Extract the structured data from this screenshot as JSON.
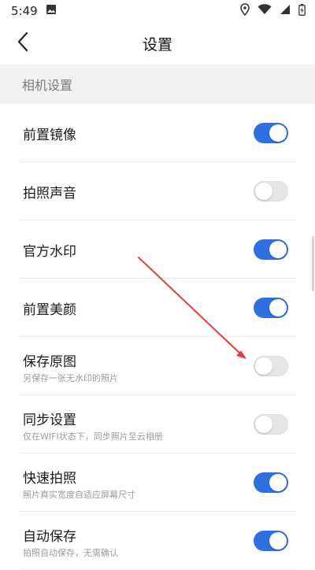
{
  "status_bar": {
    "time": "5:49",
    "icons": [
      "image-icon",
      "location-icon",
      "wifi-icon",
      "signal-icon",
      "battery-icon"
    ]
  },
  "app_bar": {
    "title": "设置",
    "back_icon": "chevron-left-icon"
  },
  "section": {
    "title": "相机设置"
  },
  "settings": [
    {
      "title": "前置镜像",
      "subtitle": "",
      "enabled": true
    },
    {
      "title": "拍照声音",
      "subtitle": "",
      "enabled": false
    },
    {
      "title": "官方水印",
      "subtitle": "",
      "enabled": true
    },
    {
      "title": "前置美颜",
      "subtitle": "",
      "enabled": true
    },
    {
      "title": "保存原图",
      "subtitle": "另保存一张无水印的照片",
      "enabled": false
    },
    {
      "title": "同步设置",
      "subtitle": "仅在WIFI状态下，同步照片至云相册",
      "enabled": false
    },
    {
      "title": "快速拍照",
      "subtitle": "照片真实宽度自适应屏幕尺寸",
      "enabled": true
    },
    {
      "title": "自动保存",
      "subtitle": "拍照自动保存，无需确认",
      "enabled": true
    }
  ],
  "colors": {
    "accent": "#2f6fe0",
    "annotation_arrow": "#e04040"
  }
}
